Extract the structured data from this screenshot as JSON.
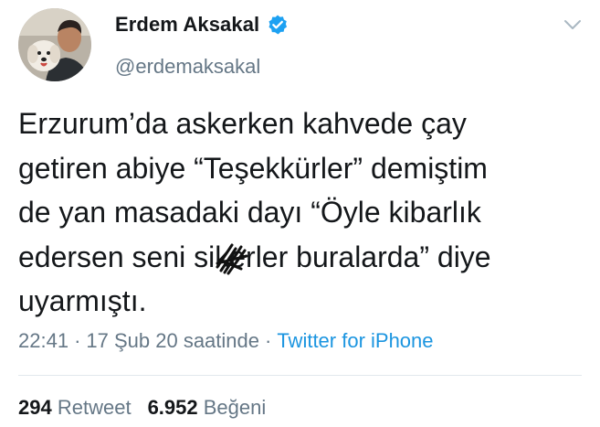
{
  "user": {
    "display_name": "Erdem Aksakal",
    "handle": "@erdemaksakal",
    "verified_icon": "verified-badge-icon",
    "accent_color": "#1da1f2"
  },
  "tweet": {
    "lines": [
      "Erzurum’da askerken kahvede çay",
      "getiren abiye “Teşekkürler” demiştim",
      "de yan masadaki dayı “Öyle kibarlık",
      "edersen seni sikerler buralarda” diye",
      "uyarmıştı."
    ]
  },
  "meta": {
    "time": "22:41",
    "separator": "·",
    "date": "17 Şub 20 saatinde",
    "source": "Twitter for iPhone"
  },
  "stats": {
    "retweets_count": "294",
    "retweets_label": "Retweet",
    "likes_count": "6.952",
    "likes_label": "Beğeni"
  },
  "colors": {
    "text": "#14171a",
    "secondary": "#657786",
    "link": "#1b95e0",
    "divider": "#e1e8ed"
  }
}
